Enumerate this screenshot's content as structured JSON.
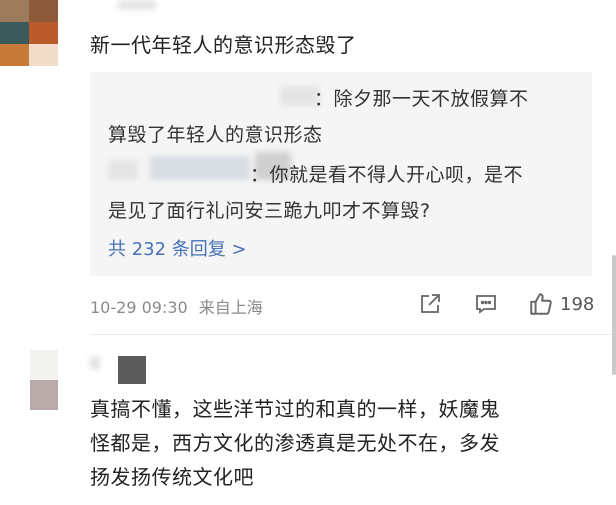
{
  "comment1": {
    "text": "新一代年轻人的意识形态毁了",
    "replies": [
      {
        "author_suffix": "：",
        "line1": "除夕那一天不放假算不",
        "line2": "算毁了年轻人的意识形态"
      },
      {
        "author_suffix": "：",
        "line1": "你就是看不得人开心呗，是不",
        "line2": "是见了面行礼问安三跪九叩才不算毁?"
      }
    ],
    "more_replies": "共 232 条回复 >",
    "timestamp": "10-29 09:30",
    "location": "来自上海",
    "like_count": "198"
  },
  "comment2": {
    "line1": "真搞不懂，这些洋节过的和真的一样，妖魔鬼",
    "line2": "怪都是，西方文化的渗透真是无处不在，多发",
    "line3": "扬发扬传统文化吧"
  },
  "colors": {
    "link": "#4670b8",
    "meta": "#8a8a8a",
    "reply_bg": "#f5f5f5"
  },
  "icons": [
    "share-icon",
    "comment-icon",
    "like-icon"
  ]
}
